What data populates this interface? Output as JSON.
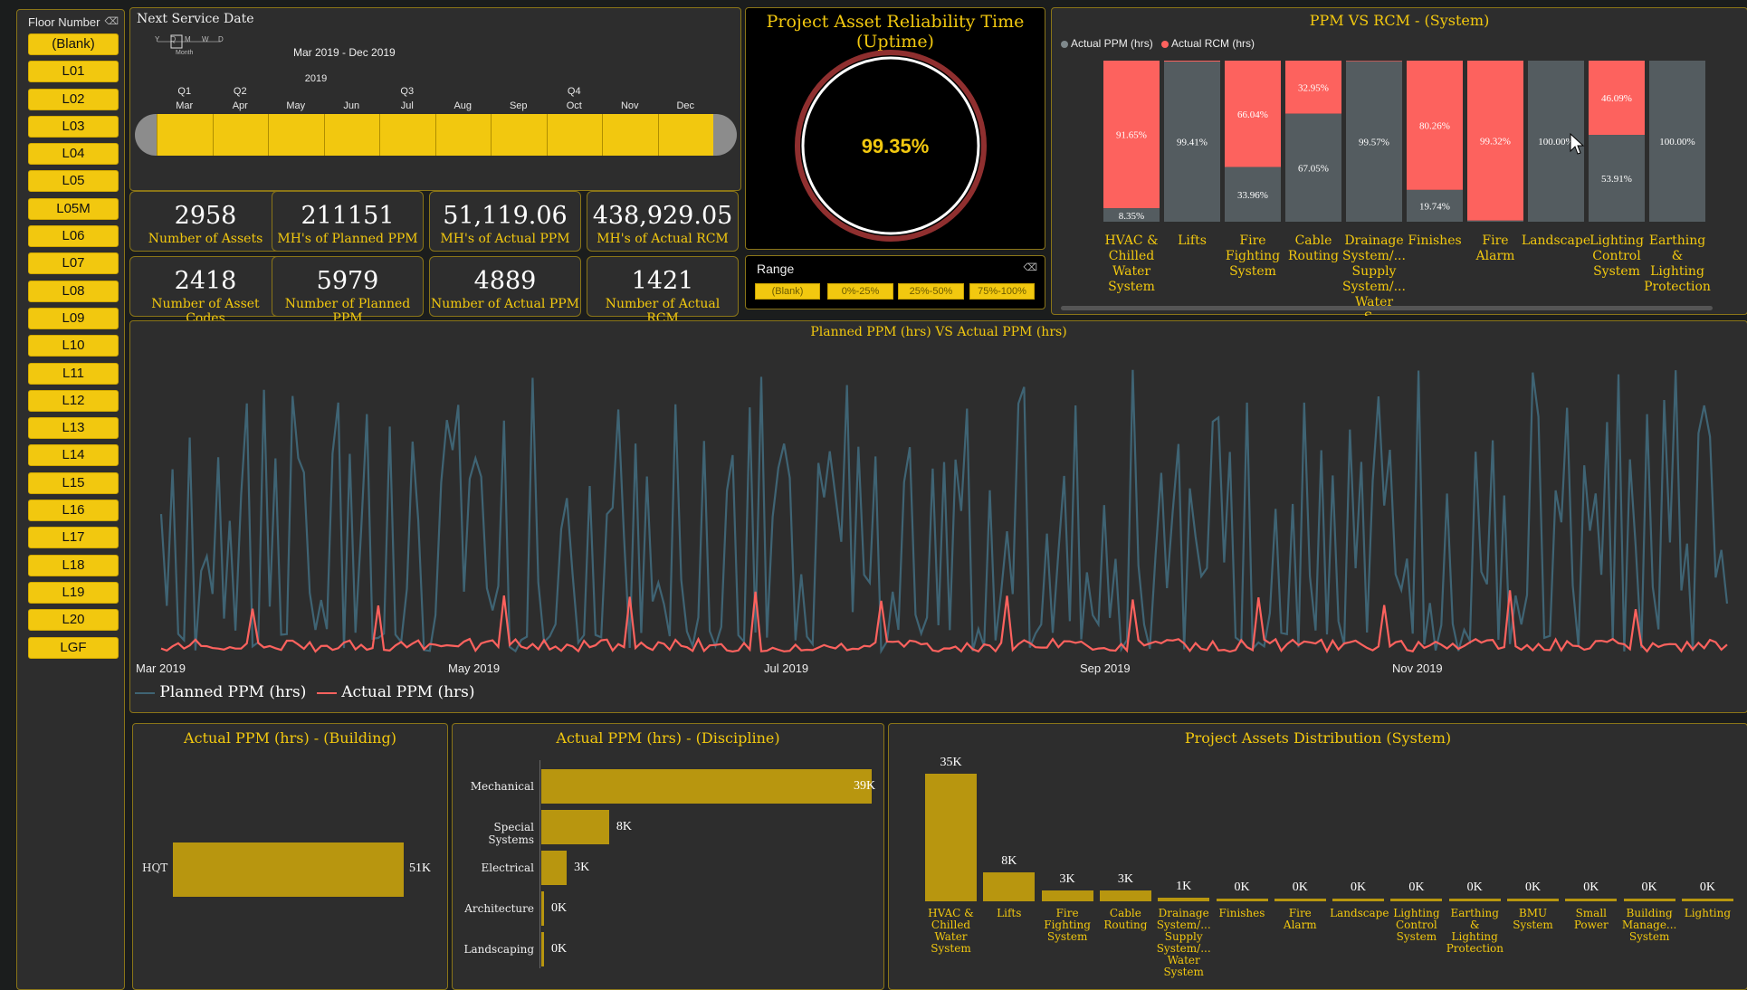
{
  "floor_slicer": {
    "title": "Floor Number",
    "items": [
      "(Blank)",
      "L01",
      "L02",
      "L03",
      "L04",
      "L05",
      "L05M",
      "L06",
      "L07",
      "L08",
      "L09",
      "L10",
      "L11",
      "L12",
      "L13",
      "L14",
      "L15",
      "L16",
      "L17",
      "L18",
      "L19",
      "L20",
      "LGF"
    ]
  },
  "date_slicer": {
    "title": "Next Service Date",
    "range": "Mar 2019 - Dec 2019",
    "granularity": {
      "options": [
        "Y",
        "Q",
        "M",
        "W",
        "D"
      ],
      "selected": "Month"
    },
    "year": "2019",
    "quarters": [
      "Q1",
      "Q2",
      "Q3",
      "Q4"
    ],
    "months": [
      "Mar",
      "Apr",
      "May",
      "Jun",
      "Jul",
      "Aug",
      "Sep",
      "Oct",
      "Nov",
      "Dec"
    ]
  },
  "gauge": {
    "title": "Project Asset Reliability Time (Uptime)",
    "value": "99.35%"
  },
  "range_slicer": {
    "title": "Range",
    "options": [
      "(Blank)",
      "0%-25%",
      "25%-50%",
      "75%-100%"
    ]
  },
  "cards": [
    {
      "value": "2958",
      "label": "Number of Assets"
    },
    {
      "value": "211151",
      "label": "MH's of Planned PPM"
    },
    {
      "value": "51,119.06",
      "label": "MH's of Actual PPM"
    },
    {
      "value": "438,929.05",
      "label": "MH's of Actual RCM"
    },
    {
      "value": "2418",
      "label": "Number of Asset Codes"
    },
    {
      "value": "5979",
      "label": "Number of Planned PPM"
    },
    {
      "value": "4889",
      "label": "Number of Actual PPM"
    },
    {
      "value": "1421",
      "label": "Number of Actual RCM"
    }
  ],
  "ppm_vs_rcm": {
    "title": "PPM VS RCM - (System)",
    "legend": [
      "Actual PPM (hrs)",
      "Actual RCM (hrs)"
    ],
    "colors": {
      "ppm": "#545c60",
      "rcm": "#fd625e"
    },
    "categories": [
      {
        "name": "HVAC & Chilled Water System",
        "ppm": 8.35,
        "rcm": 91.65,
        "ppm_label": "8.35%",
        "rcm_label": "91.65%"
      },
      {
        "name": "Lifts",
        "ppm": 99.41,
        "rcm": 0.59,
        "ppm_label": "99.41%",
        "rcm_label": ""
      },
      {
        "name": "Fire Fighting System",
        "ppm": 33.96,
        "rcm": 66.04,
        "ppm_label": "33.96%",
        "rcm_label": "66.04%"
      },
      {
        "name": "Cable Routing",
        "ppm": 67.05,
        "rcm": 32.95,
        "ppm_label": "67.05%",
        "rcm_label": "32.95%"
      },
      {
        "name": "Drainage System/... Supply System/... Water S...",
        "ppm": 99.57,
        "rcm": 0.43,
        "ppm_label": "99.57%",
        "rcm_label": ""
      },
      {
        "name": "Finishes",
        "ppm": 19.74,
        "rcm": 80.26,
        "ppm_label": "19.74%",
        "rcm_label": "80.26%"
      },
      {
        "name": "Fire Alarm",
        "ppm": 0.68,
        "rcm": 99.32,
        "ppm_label": "",
        "rcm_label": "99.32%"
      },
      {
        "name": "Landscape",
        "ppm": 100.0,
        "rcm": 0.0,
        "ppm_label": "100.00%",
        "rcm_label": ""
      },
      {
        "name": "Lighting Control System",
        "ppm": 53.91,
        "rcm": 46.09,
        "ppm_label": "53.91%",
        "rcm_label": "46.09%"
      },
      {
        "name": "Earthing & Lighting Protection",
        "ppm": 100.0,
        "rcm": 0.0,
        "ppm_label": "100.00%",
        "rcm_label": ""
      }
    ]
  },
  "line_chart": {
    "title": "Planned PPM (hrs) VS Actual PPM (hrs)",
    "x_ticks": [
      "Mar 2019",
      "May 2019",
      "Jul 2019",
      "Sep 2019",
      "Nov 2019"
    ],
    "legend": [
      "Planned PPM (hrs)",
      "Actual PPM (hrs)"
    ],
    "colors": {
      "planned": "#3f6474",
      "actual": "#fd625e"
    }
  },
  "building_chart": {
    "title": "Actual PPM (hrs) - (Building)",
    "categories": [
      "HQT"
    ],
    "values": [
      51
    ],
    "labels": [
      "51K"
    ]
  },
  "discipline_chart": {
    "title": "Actual PPM (hrs) -  (Discipline)",
    "categories": [
      "Mechanical",
      "Special Systems",
      "Electrical",
      "Architecture",
      "Landscaping"
    ],
    "values": [
      39,
      8,
      3,
      0.2,
      0.1
    ],
    "labels": [
      "39K",
      "8K",
      "3K",
      "0K",
      "0K"
    ]
  },
  "distribution_chart": {
    "title": "Project Assets Distribution (System)",
    "categories": [
      "HVAC & Chilled Water System",
      "Lifts",
      "Fire Fighting System",
      "Cable Routing",
      "Drainage System/... Supply System/... Water System",
      "Finishes",
      "Fire Alarm",
      "Landscape",
      "Lighting Control System",
      "Earthing & Lighting Protection",
      "BMU System",
      "Small Power",
      "Building Manage... System",
      "Lighting"
    ],
    "values": [
      35,
      8,
      3,
      3,
      1,
      0.2,
      0.1,
      0.1,
      0.1,
      0.1,
      0.1,
      0.1,
      0.1,
      0.1
    ],
    "labels": [
      "35K",
      "8K",
      "3K",
      "3K",
      "1K",
      "0K",
      "0K",
      "0K",
      "0K",
      "0K",
      "0K",
      "0K",
      "0K",
      "0K"
    ]
  },
  "chart_data": [
    {
      "type": "bar",
      "title": "PPM VS RCM - (System)",
      "categories": [
        "HVAC & Chilled Water System",
        "Lifts",
        "Fire Fighting System",
        "Cable Routing",
        "Drainage System/... Supply System/... Water S...",
        "Finishes",
        "Fire Alarm",
        "Landscape",
        "Lighting Control System",
        "Earthing & Lighting Protection"
      ],
      "series": [
        {
          "name": "Actual PPM (hrs)",
          "values": [
            8.35,
            99.41,
            33.96,
            67.05,
            99.57,
            19.74,
            0.68,
            100.0,
            53.91,
            100.0
          ]
        },
        {
          "name": "Actual RCM (hrs)",
          "values": [
            91.65,
            0.59,
            66.04,
            32.95,
            0.43,
            80.26,
            99.32,
            0.0,
            46.09,
            0.0
          ]
        }
      ]
    },
    {
      "type": "bar",
      "title": "Actual PPM (hrs) -  (Discipline)",
      "categories": [
        "Mechanical",
        "Special Systems",
        "Electrical",
        "Architecture",
        "Landscaping"
      ],
      "values": [
        39000,
        8000,
        3000,
        200,
        100
      ]
    },
    {
      "type": "bar",
      "title": "Project Assets Distribution (System)",
      "values": [
        35000,
        8000,
        3000,
        3000,
        1000,
        200,
        100,
        100,
        100,
        100,
        100,
        100,
        100,
        100
      ]
    }
  ]
}
